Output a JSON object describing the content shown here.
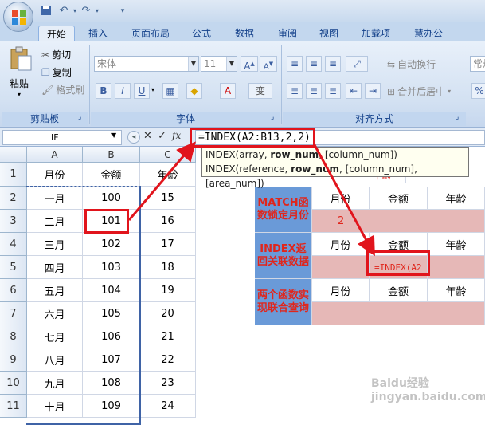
{
  "quick_access": {
    "save_icon": "save-icon",
    "undo_icon": "undo-icon",
    "redo_icon": "redo-icon"
  },
  "tabs": [
    "开始",
    "插入",
    "页面布局",
    "公式",
    "数据",
    "审阅",
    "视图",
    "加载项",
    "慧办公"
  ],
  "ribbon": {
    "clipboard": {
      "paste": "粘贴",
      "cut": "剪切",
      "copy": "复制",
      "format_painter": "格式刷",
      "label": "剪贴板"
    },
    "font": {
      "name": "宋体",
      "size": "11",
      "label": "字体",
      "bold": "B",
      "italic": "I",
      "underline": "U",
      "grow": "A",
      "shrink": "A",
      "pinyin": "变"
    },
    "alignment": {
      "wrap": "自动换行",
      "merge": "合并后居中",
      "label": "对齐方式"
    },
    "number": {
      "format": "常规"
    }
  },
  "formula_bar": {
    "name_box": "IF",
    "fx": "fx",
    "formula": "=INDEX(A2:B13,2,2)"
  },
  "tooltip": {
    "line1_pre": "INDEX(array, ",
    "line1_bold": "row_num",
    "line1_post": ", [column_num])",
    "line2_pre": "INDEX(reference, ",
    "line2_bold": "row_num",
    "line2_post": ", [column_num], [area_num])"
  },
  "columns": [
    "A",
    "B",
    "C"
  ],
  "rows": [
    "1",
    "2",
    "3",
    "4",
    "5",
    "6",
    "7",
    "8",
    "9",
    "10",
    "11"
  ],
  "table": {
    "header": [
      "月份",
      "金额",
      "年龄"
    ],
    "data": [
      [
        "一月",
        "100",
        "15"
      ],
      [
        "二月",
        "101",
        "16"
      ],
      [
        "三月",
        "102",
        "17"
      ],
      [
        "四月",
        "103",
        "18"
      ],
      [
        "五月",
        "104",
        "19"
      ],
      [
        "六月",
        "105",
        "20"
      ],
      [
        "七月",
        "106",
        "21"
      ],
      [
        "八月",
        "107",
        "22"
      ],
      [
        "九月",
        "108",
        "23"
      ],
      [
        "十月",
        "109",
        "24"
      ]
    ]
  },
  "side": {
    "top_partial": "年龄",
    "match_label": "MATCH函数锁定月份",
    "index_label": "INDEX返回关联数据",
    "combo_label": "两个函数实现联合查询",
    "headers": [
      "月份",
      "金额",
      "年龄"
    ],
    "match_value": "2",
    "index_cell": "=INDEX(A2"
  },
  "watermark": "Baidu经验 jingyan.baidu.com",
  "colors": {
    "accent_red": "#e1141c",
    "blue_fill": "#6a9ad8",
    "pink_fill": "#e6b8b7"
  }
}
